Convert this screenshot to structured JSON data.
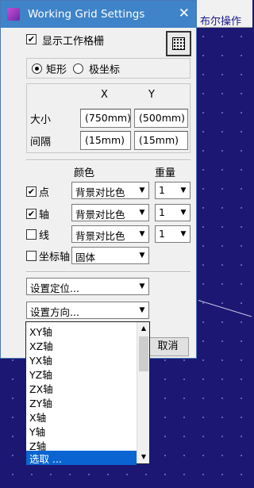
{
  "window": {
    "title": "Working Grid Settings",
    "close_icon": "close-icon"
  },
  "background": {
    "toolbar_fragment": "布尔操作"
  },
  "show_grid": {
    "checked": true,
    "label": "显示工作格栅",
    "icon": "grid-icon"
  },
  "coord_mode": {
    "options": [
      {
        "label": "矩形",
        "selected": true
      },
      {
        "label": "极坐标",
        "selected": false
      }
    ]
  },
  "dimensions": {
    "col_x": "X",
    "col_y": "Y",
    "size_label": "大小",
    "size_x": "(750mm)",
    "size_y": "(500mm)",
    "spacing_label": "间隔",
    "spacing_x": "(15mm)",
    "spacing_y": "(15mm)"
  },
  "appearance": {
    "color_header": "颜色",
    "weight_header": "重量",
    "rows": [
      {
        "label": "点",
        "checked": true,
        "color": "背景对比色",
        "weight": "1"
      },
      {
        "label": "轴",
        "checked": true,
        "color": "背景对比色",
        "weight": "1"
      },
      {
        "label": "线",
        "checked": false,
        "color": "背景对比色",
        "weight": "1"
      }
    ],
    "axis_row": {
      "label": "坐标轴",
      "checked": false,
      "value": "固体"
    }
  },
  "positioning": {
    "set_position": "设置定位...",
    "set_direction": "设置方向..."
  },
  "buttons": {
    "cancel": "取消"
  },
  "direction_list": {
    "items": [
      "XY轴",
      "XZ轴",
      "YX轴",
      "YZ轴",
      "ZX轴",
      "ZY轴",
      "X轴",
      "Y轴",
      "Z轴",
      "选取 ..."
    ],
    "selected": "选取 ..."
  }
}
